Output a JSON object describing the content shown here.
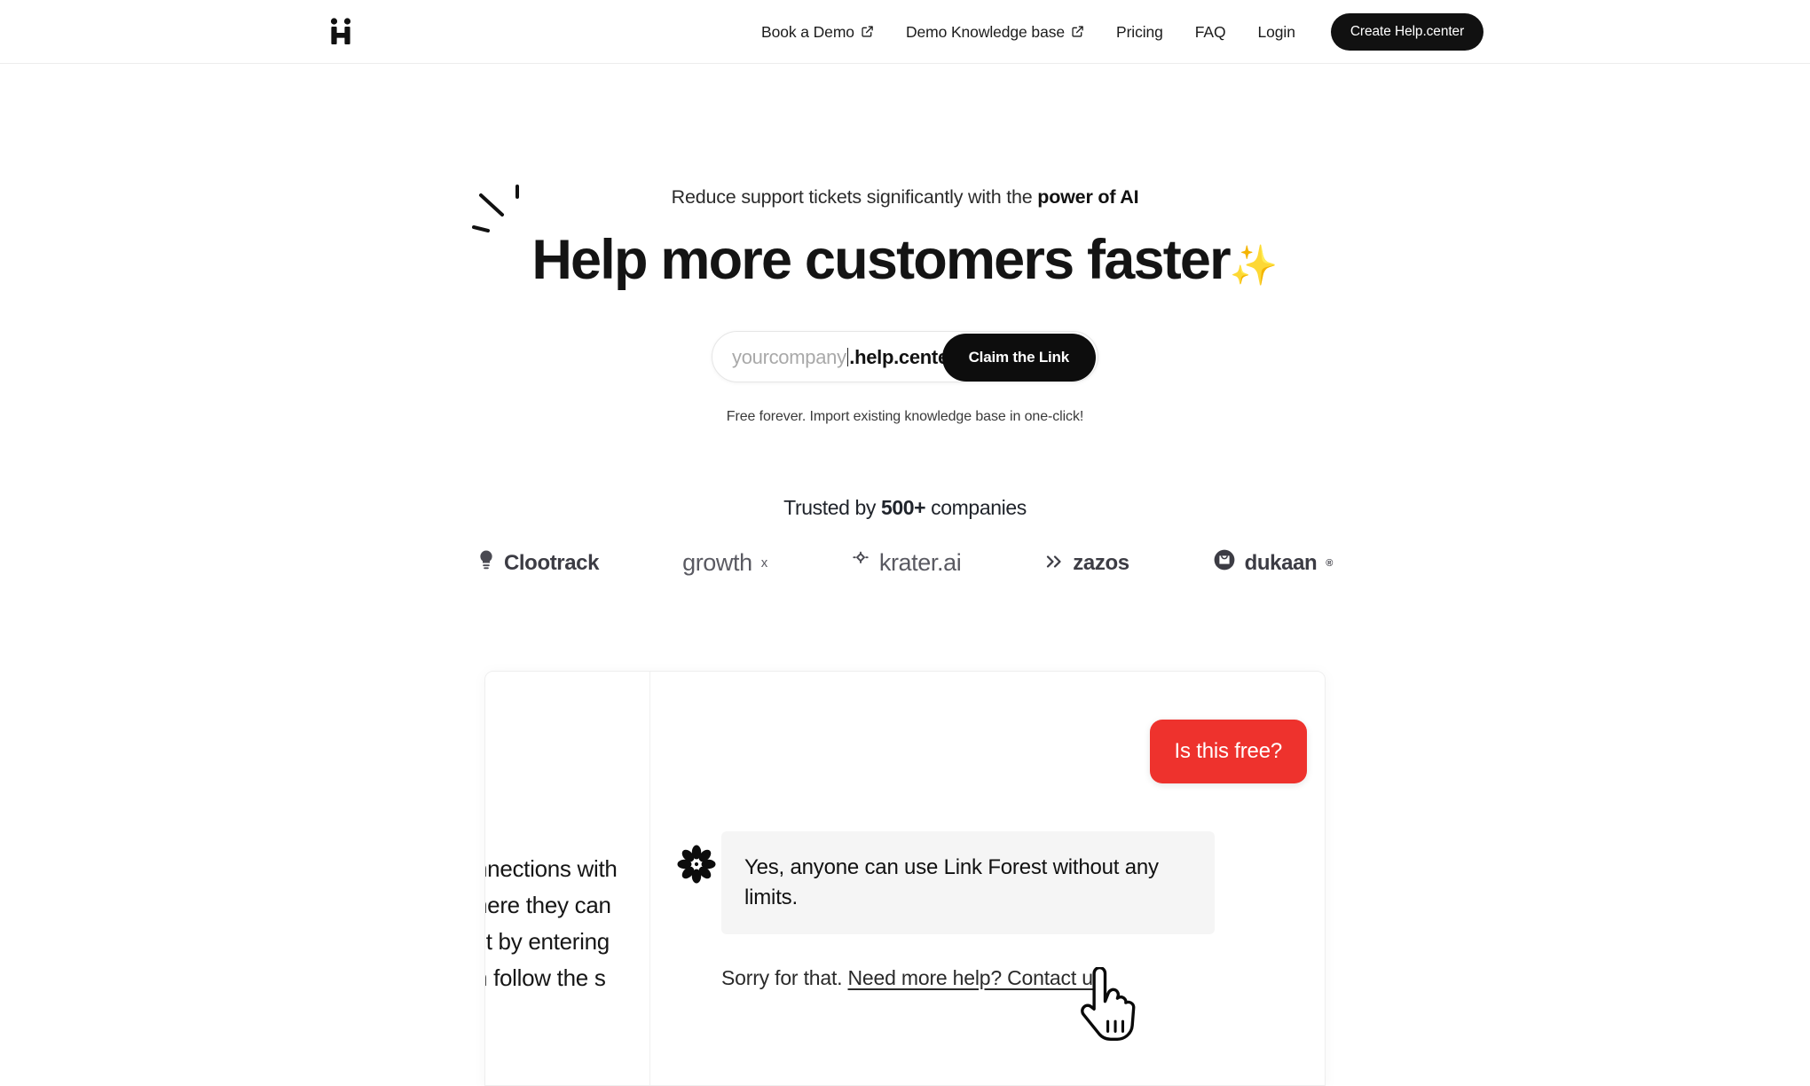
{
  "nav": {
    "logo_name": "help-center-logo",
    "links": [
      {
        "label": "Book a Demo",
        "external": true
      },
      {
        "label": "Demo Knowledge base",
        "external": true
      },
      {
        "label": "Pricing",
        "external": false
      },
      {
        "label": "FAQ",
        "external": false
      },
      {
        "label": "Login",
        "external": false
      }
    ],
    "cta_label": "Create Help.center"
  },
  "hero": {
    "eyebrow_prefix": "Reduce support tickets significantly with the ",
    "eyebrow_bold": "power of AI",
    "headline": "Help more customers faster",
    "headline_emoji": "✨",
    "claim": {
      "placeholder": "yourcompany",
      "domain_suffix": ".help.center",
      "button_label": "Claim the Link"
    },
    "free_note": "Free forever. Import existing knowledge base in one-click!"
  },
  "trusted": {
    "title_prefix": "Trusted by ",
    "title_bold": "500+",
    "title_suffix": " companies",
    "logos": [
      {
        "name": "clootrack",
        "label": "Clootrack",
        "icon": "lightbulb-icon",
        "style": "bold"
      },
      {
        "name": "growthx",
        "label": "growth",
        "sup": "x",
        "icon": "",
        "style": "light"
      },
      {
        "name": "krater-ai",
        "label": "krater.ai",
        "icon": "diamond-icon",
        "style": "light"
      },
      {
        "name": "zazos",
        "label": "zazos",
        "icon": "chevrons-right-icon",
        "style": "bold"
      },
      {
        "name": "dukaan",
        "label": "dukaan",
        "reg": "®",
        "icon": "shopping-bag-circle-icon",
        "style": "bold"
      }
    ]
  },
  "demo": {
    "background_article_lines": [
      "nnections with",
      "here they can",
      "st by entering",
      "n follow the s"
    ],
    "messages": [
      {
        "role": "user",
        "text": "Is this free?"
      },
      {
        "role": "bot",
        "text": "Yes, anyone can use Link Forest without any limits.",
        "avatar": "flower-avatar-icon"
      }
    ],
    "followup": {
      "text": "Sorry for that. ",
      "link_label": "Need more help? Contact us"
    }
  },
  "colors": {
    "accent_red": "#ee322d",
    "dark": "#111111",
    "bot_bubble": "#f5f5f5",
    "muted_text": "#a9a9a9"
  }
}
